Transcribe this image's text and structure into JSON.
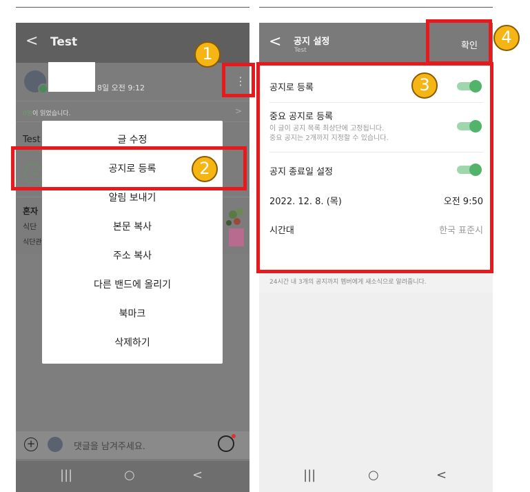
{
  "left": {
    "header": {
      "back": "<",
      "title": "Test"
    },
    "post": {
      "date": "8일 오전 9:12",
      "read_count": "0명",
      "read_suffix": "이 읽었습니다.",
      "body": "Test"
    },
    "band_card": {
      "title": "혼자",
      "line1": "식단",
      "line2": "식단관"
    },
    "menu": [
      {
        "label": "글 수정"
      },
      {
        "label": "공지로 등록"
      },
      {
        "label": "알림 보내기"
      },
      {
        "label": "본문 복사"
      },
      {
        "label": "주소 복사"
      },
      {
        "label": "다른 밴드에 올리기"
      },
      {
        "label": "북마크"
      },
      {
        "label": "삭제하기"
      }
    ],
    "comment_placeholder": "댓글을 남겨주세요.",
    "nav": {
      "recent": "|||",
      "home": "○",
      "back": "<"
    }
  },
  "right": {
    "header": {
      "back": "<",
      "title": "공지 설정",
      "subtitle": "Test",
      "confirm": "확인"
    },
    "settings": {
      "register_notice": {
        "label": "공지로 등록",
        "on": true
      },
      "important_notice": {
        "label": "중요 공지로 등록",
        "desc1": "이 글이 공지 목록 최상단에 고정됩니다.",
        "desc2": "중요 공지는 2개까지 지정할 수 있습니다.",
        "on": true
      },
      "end_date": {
        "label": "공지 종료일 설정",
        "on": true
      },
      "date": "2022. 12. 8. (목)",
      "time": "오전 9:50",
      "timezone_label": "시간대",
      "timezone_value": "한국 표준시"
    },
    "footnote": "24시간 내 3개의 공지까지 멤버에게 새소식으로 알려줍니다.",
    "nav": {
      "recent": "|||",
      "home": "○",
      "back": "<"
    }
  },
  "annotations": [
    "1",
    "2",
    "3",
    "4"
  ],
  "colors": {
    "highlight": "#e8191c",
    "badge": "#f5b514",
    "toggle_on": "#52b36a"
  }
}
